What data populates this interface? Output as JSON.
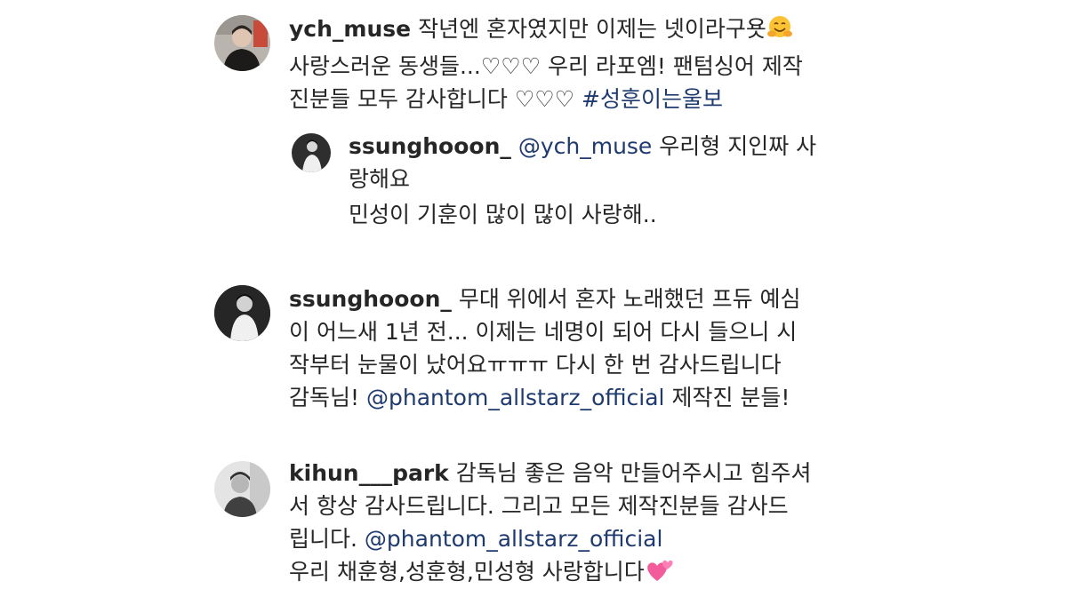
{
  "comments": [
    {
      "username": "ych_muse",
      "lines": [
        "작년엔 혼자였지만  이제는 넷이라구욧",
        "사랑스러운 동생들...♡♡♡ 우리 라포엠! 팬텀싱어 제작",
        "진분들 모두 감사합니다 ♡♡♡ "
      ],
      "hashtag": "#성훈이는울보",
      "emoji": "hugging-face-emoji",
      "reply": {
        "username": "ssunghooon_",
        "mention": "@ych_muse",
        "lines": [
          " 우리형 지인짜 사",
          "랑해요",
          "민성이 기훈이 많이 많이 사랑해.."
        ]
      }
    },
    {
      "username": "ssunghooon_",
      "lines": [
        " 무대 위에서 혼자 노래했던 프듀 예심",
        "이 어느새 1년 전... 이제는 네명이 되어 다시 들으니 시",
        "작부터 눈물이 났어요ㅠㅠㅠ 다시 한 번 감사드립니다",
        "감독님! "
      ],
      "mention": "@phantom_allstarz_official",
      "tail": " 제작진 분들!"
    },
    {
      "username": "kihun___park",
      "lines": [
        " 감독님 좋은 음악 만들어주시고 힘주셔",
        "서 항상 감사드립니다. 그리고 모든 제작진분들 감사드",
        "립니다.  ",
        "우리 채훈형,성훈형,민성형 사랑합니다"
      ],
      "mention": "@phantom_allstarz_official",
      "emoji": "two-hearts-emoji"
    }
  ],
  "colors": {
    "text": "#262626",
    "mention": "#1e3a6e"
  }
}
